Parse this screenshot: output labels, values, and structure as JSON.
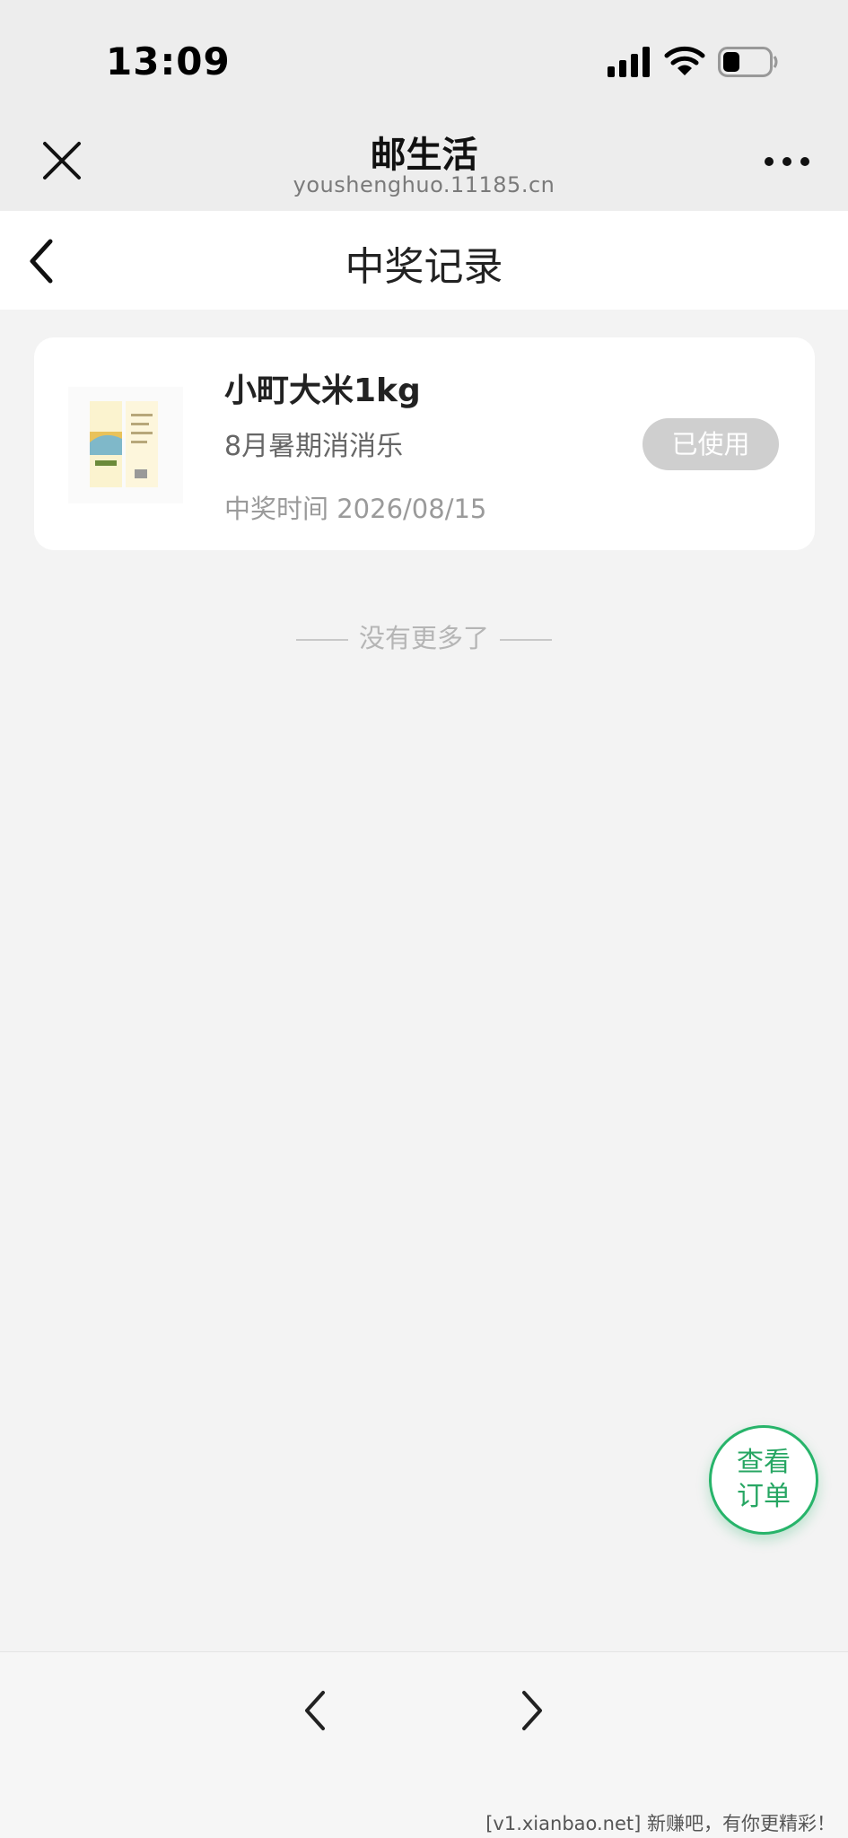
{
  "status_bar": {
    "time": "13:09"
  },
  "wechat_nav": {
    "title": "邮生活",
    "url": "youshenghuo.11185.cn"
  },
  "page": {
    "title": "中奖记录"
  },
  "prize": {
    "name": "小町大米1kg",
    "activity": "8月暑期消消乐",
    "time_label": "中奖时间",
    "time_value": "2026/08/15",
    "status": "已使用"
  },
  "list_end": "没有更多了",
  "floating_button": {
    "line1": "查看",
    "line2": "订单"
  },
  "watermark": "[v1.xianbao.net] 新赚吧，有你更精彩！",
  "colors": {
    "accent_green": "#27b46a",
    "status_gray": "#cfcfcf",
    "background": "#f3f3f3"
  }
}
